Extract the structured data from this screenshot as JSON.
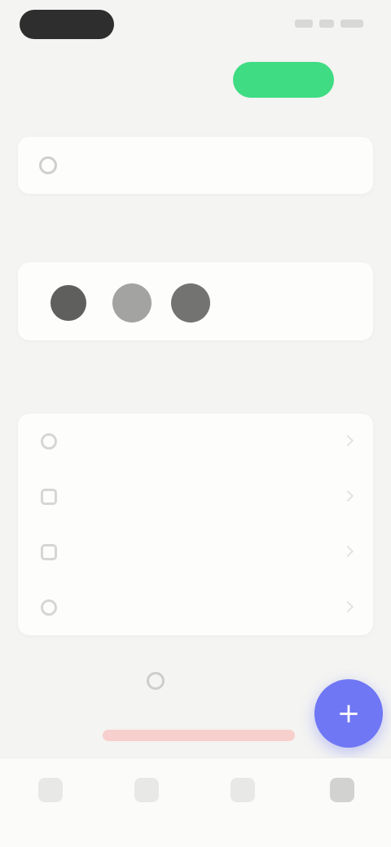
{
  "status": {
    "time": ""
  },
  "header": {
    "title": "",
    "action_label": ""
  },
  "search": {
    "placeholder": ""
  },
  "recent": {
    "title": "",
    "avatars": [
      {
        "color": "#5f5f5d"
      },
      {
        "color": "#9a9a98"
      },
      {
        "color": "#6c6c6a"
      }
    ]
  },
  "menu": {
    "title": "",
    "items": [
      {
        "label": "",
        "icon": "user-icon"
      },
      {
        "label": "",
        "icon": "shield-icon"
      },
      {
        "label": "",
        "icon": "bell-icon"
      },
      {
        "label": "",
        "icon": "help-icon"
      }
    ]
  },
  "more": {
    "label": ""
  },
  "fab": {
    "label": "+",
    "color": "#6f77f4"
  },
  "nav": {
    "items": [
      {
        "label": "",
        "icon": "home-icon"
      },
      {
        "label": "",
        "icon": "chat-icon"
      },
      {
        "label": "",
        "icon": "search-icon"
      },
      {
        "label": "",
        "icon": "profile-icon"
      }
    ]
  },
  "colors": {
    "accent": "#3fdc83",
    "fab": "#6f77f4",
    "danger": "#f7cfcc"
  }
}
